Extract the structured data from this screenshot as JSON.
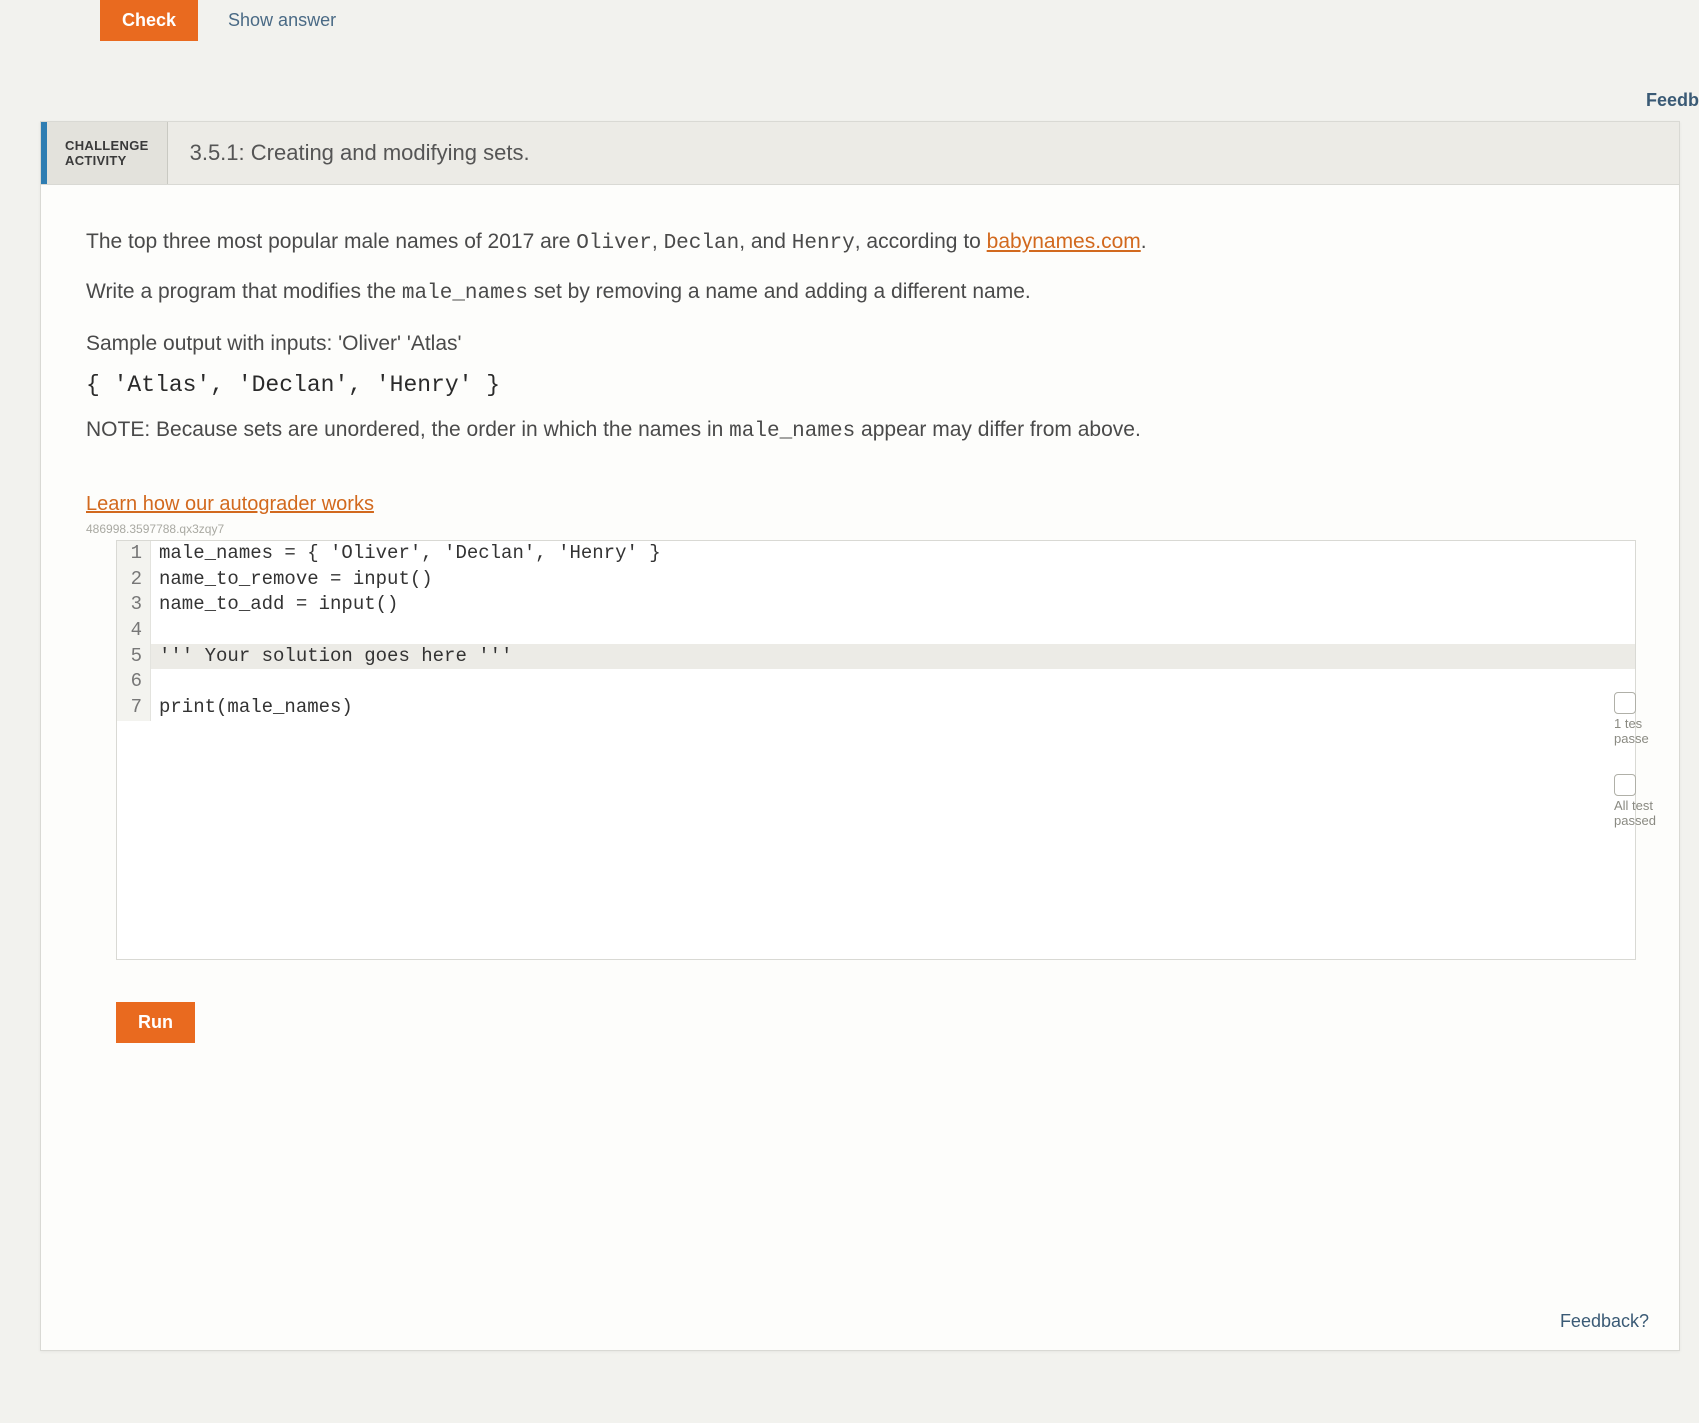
{
  "top": {
    "check_label": "Check",
    "show_answer_label": "Show answer",
    "feedback_label": "Feedb"
  },
  "activity": {
    "badge_line1": "CHALLENGE",
    "badge_line2": "ACTIVITY",
    "number": "3.5.1:",
    "title": "Creating and modifying sets."
  },
  "prompt": {
    "intro_pre": "The top three most popular male names of 2017 are ",
    "name1": "Oliver",
    "sep1": ", ",
    "name2": "Declan",
    "sep2": ", and ",
    "name3": "Henry",
    "intro_post": ", according to ",
    "link_text": "babynames.com",
    "intro_end": ".",
    "task_pre": "Write a program that modifies the ",
    "task_code": "male_names",
    "task_post": " set by removing a name and adding a different name.",
    "sample_label": "Sample output with inputs: 'Oliver' 'Atlas'",
    "sample_output": "{ 'Atlas', 'Declan', 'Henry' }",
    "note_pre": "NOTE: Because sets are unordered, the order in which the names in ",
    "note_code": "male_names",
    "note_post": " appear may differ from above."
  },
  "autograder_link": "Learn how our autograder works",
  "hash": "486998.3597788.qx3zqy7",
  "code": {
    "lines": [
      "male_names = { 'Oliver', 'Declan', 'Henry' }",
      "name_to_remove = input()",
      "name_to_add = input()",
      "",
      "''' Your solution goes here '''",
      "",
      "print(male_names)"
    ],
    "highlight_index": 4
  },
  "run_label": "Run",
  "side": {
    "ind1_line1": "1 tes",
    "ind1_line2": "passe",
    "ind2_line1": "All test",
    "ind2_line2": "passed"
  },
  "feedback_bottom": "Feedback?"
}
